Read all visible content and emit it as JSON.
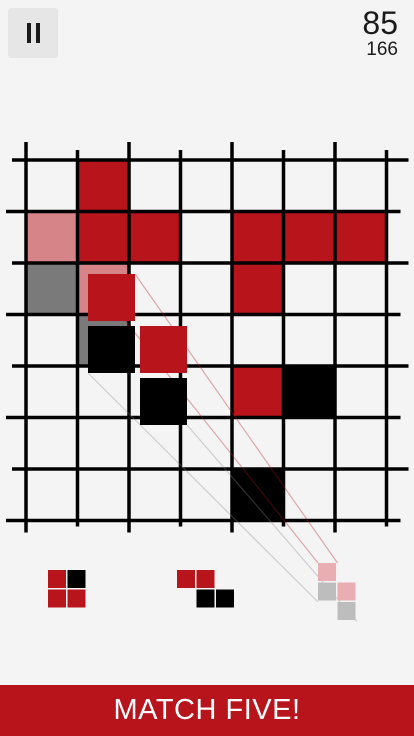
{
  "header": {
    "pause_icon": "pause-icon",
    "score": "85",
    "best_score": "166"
  },
  "colors": {
    "background": "#f4f4f4",
    "grid_line": "#000000",
    "red": "#b8141c",
    "black": "#000000",
    "banner": "#b8141c"
  },
  "board": {
    "rows": 7,
    "cols": 7,
    "filled_cells": [
      {
        "row": 0,
        "col": 1,
        "color": "red"
      },
      {
        "row": 1,
        "col": 1,
        "color": "red"
      },
      {
        "row": 1,
        "col": 2,
        "color": "red"
      },
      {
        "row": 1,
        "col": 4,
        "color": "red"
      },
      {
        "row": 1,
        "col": 5,
        "color": "red"
      },
      {
        "row": 1,
        "col": 6,
        "color": "red"
      },
      {
        "row": 2,
        "col": 4,
        "color": "red"
      },
      {
        "row": 4,
        "col": 4,
        "color": "red"
      },
      {
        "row": 4,
        "col": 5,
        "color": "black"
      },
      {
        "row": 6,
        "col": 4,
        "color": "black"
      }
    ],
    "ghost_cells": [
      {
        "row": 1,
        "col": 0,
        "color": "red"
      },
      {
        "row": 2,
        "col": 0,
        "color": "black"
      },
      {
        "row": 2,
        "col": 1,
        "color": "red"
      },
      {
        "row": 3,
        "col": 1,
        "color": "black"
      }
    ]
  },
  "dragging_piece": {
    "cells": [
      {
        "dr": 0,
        "dc": 0,
        "color": "red"
      },
      {
        "dr": 1,
        "dc": 0,
        "color": "black"
      },
      {
        "dr": 1,
        "dc": 1,
        "color": "red"
      },
      {
        "dr": 2,
        "dc": 1,
        "color": "black"
      }
    ]
  },
  "tray": [
    {
      "cells": [
        {
          "r": 0,
          "c": 0,
          "color": "red"
        },
        {
          "r": 0,
          "c": 1,
          "color": "black"
        },
        {
          "r": 1,
          "c": 0,
          "color": "red"
        },
        {
          "r": 1,
          "c": 1,
          "color": "red"
        }
      ]
    },
    {
      "cells": [
        {
          "r": 0,
          "c": 0,
          "color": "red"
        },
        {
          "r": 0,
          "c": 1,
          "color": "red"
        },
        {
          "r": 1,
          "c": 1,
          "color": "black"
        },
        {
          "r": 1,
          "c": 2,
          "color": "black"
        }
      ]
    },
    {
      "state": "dragged",
      "cells": [
        {
          "r": 0,
          "c": 0,
          "color": "red"
        },
        {
          "r": 1,
          "c": 0,
          "color": "black"
        },
        {
          "r": 1,
          "c": 1,
          "color": "red"
        },
        {
          "r": 2,
          "c": 1,
          "color": "black"
        }
      ]
    }
  ],
  "banner": {
    "text": "MATCH FIVE!"
  }
}
